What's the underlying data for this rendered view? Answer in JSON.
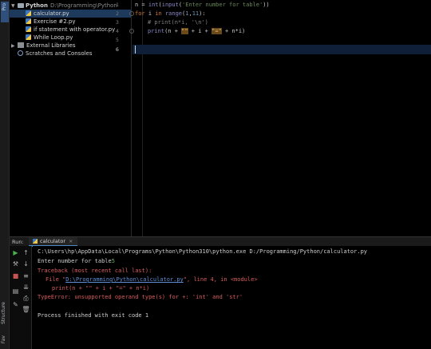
{
  "sidebar": {
    "project_tab": "Pro",
    "structure_tab": "Structure",
    "favorites_tab": "Fav"
  },
  "project_tree": {
    "root_name": "Python",
    "root_path": "D:\\Programming\\Python",
    "files": [
      "calculator.py",
      "Exercise #2.py",
      "if statement with operator.py",
      "While Loop.py"
    ],
    "external_libraries": "External Libraries",
    "scratches": "Scratches and Consoles"
  },
  "editor": {
    "line_numbers": [
      "1",
      "2",
      "3",
      "4",
      "5",
      "6"
    ],
    "lines": [
      [
        "n = ",
        "int",
        "(",
        "input",
        "(",
        "'Enter number for table'",
        "))"
      ],
      [
        "for ",
        "i ",
        "in ",
        "range",
        "(",
        "1",
        ",",
        "11",
        "):"
      ],
      [
        "# print(n*i, '\\n')"
      ],
      [
        "print",
        "(n + ",
        "\"\"",
        " + i + ",
        "\"=\"",
        " + n*i)"
      ]
    ]
  },
  "run_panel": {
    "label": "Run:",
    "tab_name": "calculator",
    "console": {
      "command": "C:\\Users\\hp\\AppData\\Local\\Programs\\Python\\Python310\\python.exe D:/Programming/Python/calculator.py",
      "prompt": "Enter number for table",
      "prompt_input": "5",
      "traceback_header": "Traceback (most recent call last):",
      "file_prefix": "File \"",
      "file_link": "D:\\Programming\\Python\\calculator.py",
      "file_suffix": "\", line 4, in <module>",
      "source_line": "print(n + \"\" + i + \"=\" + n*i)",
      "error": "TypeError: unsupported operand type(s) for +: 'int' and 'str'",
      "exit": "Process finished with exit code 1"
    }
  }
}
